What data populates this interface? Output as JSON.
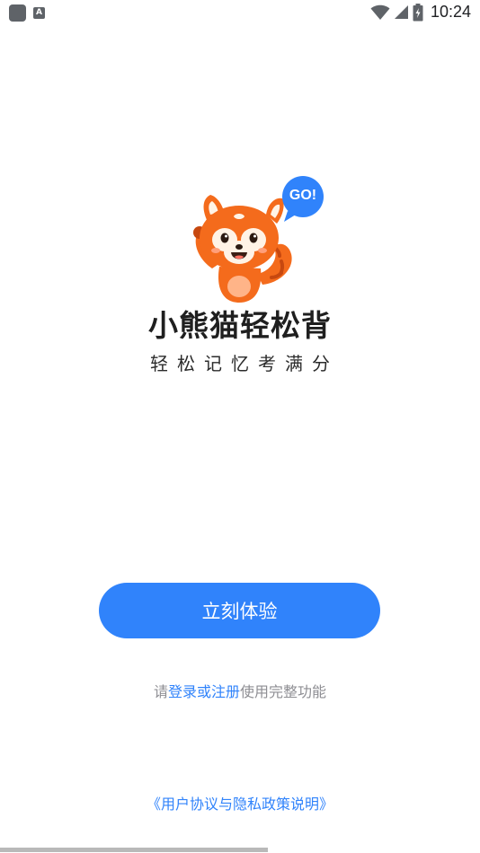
{
  "status_bar": {
    "time": "10:24",
    "left_icons": [
      "app-square-icon",
      "keyboard-a-icon"
    ],
    "right_icons": [
      "wifi-icon",
      "cell-signal-icon",
      "battery-charging-icon"
    ],
    "a_glyph": "A"
  },
  "logo": {
    "bubble_text": "GO!",
    "mascot": "red-panda-icon"
  },
  "app_name": "小熊猫轻松背",
  "slogan": "轻松记忆考满分",
  "start_button_label": "立刻体验",
  "login_hint": {
    "prefix": "请",
    "link": "登录或注册",
    "suffix": "使用完整功能"
  },
  "agreement_link": "《用户协议与隐私政策说明》",
  "colors": {
    "accent": "#3083fb",
    "mascot_orange": "#f46b1c",
    "text_dark": "#1f1f1f",
    "text_gray": "#8e8e93"
  }
}
